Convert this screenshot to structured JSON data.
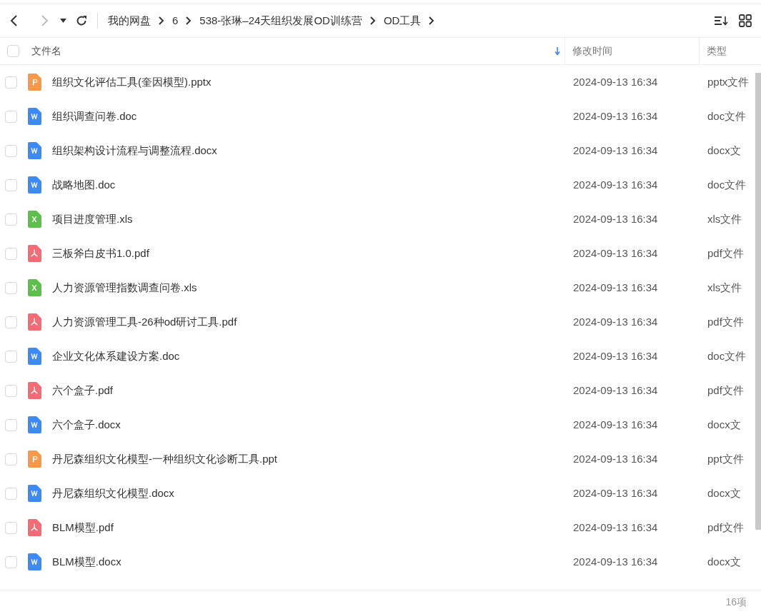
{
  "toolbar": {
    "breadcrumbs": [
      "我的网盘",
      "6",
      "538-张琳–24天组织发展OD训练营",
      "OD工具"
    ]
  },
  "table": {
    "columns": [
      {
        "label": "文件名",
        "sorted": true
      },
      {
        "label": "修改时间",
        "sorted": false
      },
      {
        "label": "类型",
        "sorted": false
      }
    ],
    "all_checked": false,
    "rows": [
      {
        "kind": "ppt",
        "name": "组织文化评估工具(奎因模型).pptx",
        "modified": "2024-09-13 16:34",
        "type": "pptx文件",
        "checked": false
      },
      {
        "kind": "word",
        "name": "组织调查问卷.doc",
        "modified": "2024-09-13 16:34",
        "type": "doc文件",
        "checked": false
      },
      {
        "kind": "word",
        "name": "组织架构设计流程与调整流程.docx",
        "modified": "2024-09-13 16:34",
        "type": "docx文",
        "checked": false
      },
      {
        "kind": "word",
        "name": "战略地图.doc",
        "modified": "2024-09-13 16:34",
        "type": "doc文件",
        "checked": false
      },
      {
        "kind": "excel",
        "name": "项目进度管理.xls",
        "modified": "2024-09-13 16:34",
        "type": "xls文件",
        "checked": false
      },
      {
        "kind": "pdf",
        "name": "三板斧白皮书1.0.pdf",
        "modified": "2024-09-13 16:34",
        "type": "pdf文件",
        "checked": false
      },
      {
        "kind": "excel",
        "name": "人力资源管理指数调查问卷.xls",
        "modified": "2024-09-13 16:34",
        "type": "xls文件",
        "checked": false
      },
      {
        "kind": "pdf",
        "name": "人力资源管理工具-26种od研讨工具.pdf",
        "modified": "2024-09-13 16:34",
        "type": "pdf文件",
        "checked": false
      },
      {
        "kind": "word",
        "name": "企业文化体系建设方案.doc",
        "modified": "2024-09-13 16:34",
        "type": "doc文件",
        "checked": false
      },
      {
        "kind": "pdf",
        "name": "六个盒子.pdf",
        "modified": "2024-09-13 16:34",
        "type": "pdf文件",
        "checked": false
      },
      {
        "kind": "word",
        "name": "六个盒子.docx",
        "modified": "2024-09-13 16:34",
        "type": "docx文",
        "checked": false
      },
      {
        "kind": "ppt",
        "name": "丹尼森组织文化模型-一种组织文化诊断工具.ppt",
        "modified": "2024-09-13 16:34",
        "type": "ppt文件",
        "checked": false
      },
      {
        "kind": "word",
        "name": "丹尼森组织文化模型.docx",
        "modified": "2024-09-13 16:34",
        "type": "docx文",
        "checked": false
      },
      {
        "kind": "pdf",
        "name": "BLM模型.pdf",
        "modified": "2024-09-13 16:34",
        "type": "pdf文件",
        "checked": false
      },
      {
        "kind": "word",
        "name": "BLM模型.docx",
        "modified": "2024-09-13 16:34",
        "type": "docx文",
        "checked": false
      }
    ]
  },
  "status_bar": {
    "count": "16项"
  }
}
